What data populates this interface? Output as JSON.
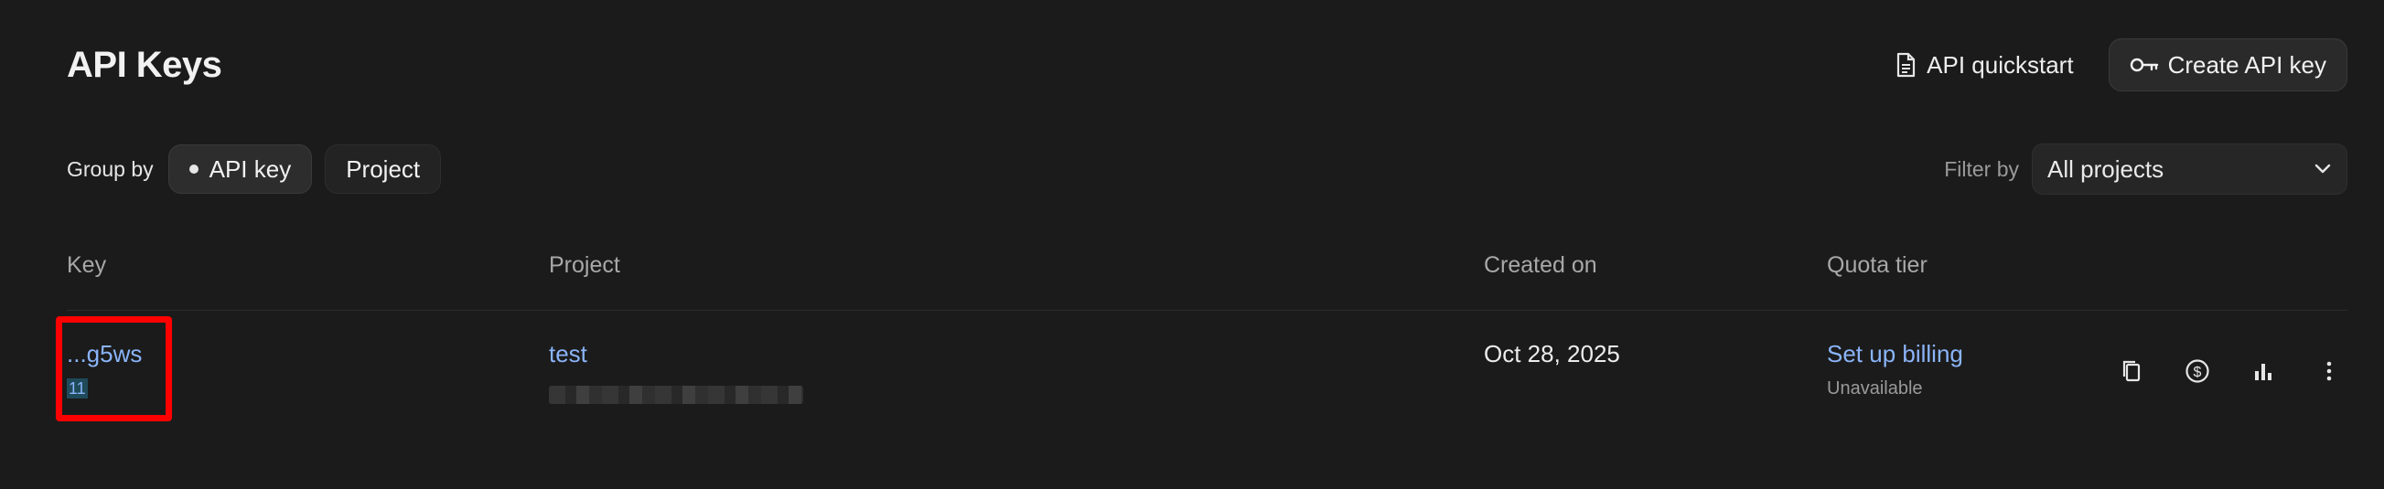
{
  "header": {
    "title": "API Keys",
    "quickstart_label": "API quickstart",
    "create_label": "Create API key"
  },
  "toolbar": {
    "group_by_label": "Group by",
    "group_options": [
      "API key",
      "Project"
    ],
    "active_group": "API key",
    "filter_label": "Filter by",
    "filter_value": "All projects"
  },
  "table": {
    "columns": [
      "Key",
      "Project",
      "Created on",
      "Quota tier"
    ],
    "rows": [
      {
        "key": "...g5ws",
        "key_sub": "11",
        "project": "test",
        "created_on": "Oct 28, 2025",
        "quota_tier": "Set up billing",
        "quota_status": "Unavailable"
      }
    ]
  },
  "icons": {
    "quickstart": "document-icon",
    "create": "key-icon",
    "select": "chevron-down-icon",
    "row_actions": [
      "copy-icon",
      "billing-icon",
      "usage-chart-icon",
      "more-vert-icon"
    ]
  },
  "colors": {
    "background": "#1b1b1b",
    "link": "#8ab4f8",
    "highlight": "#ff0000"
  }
}
